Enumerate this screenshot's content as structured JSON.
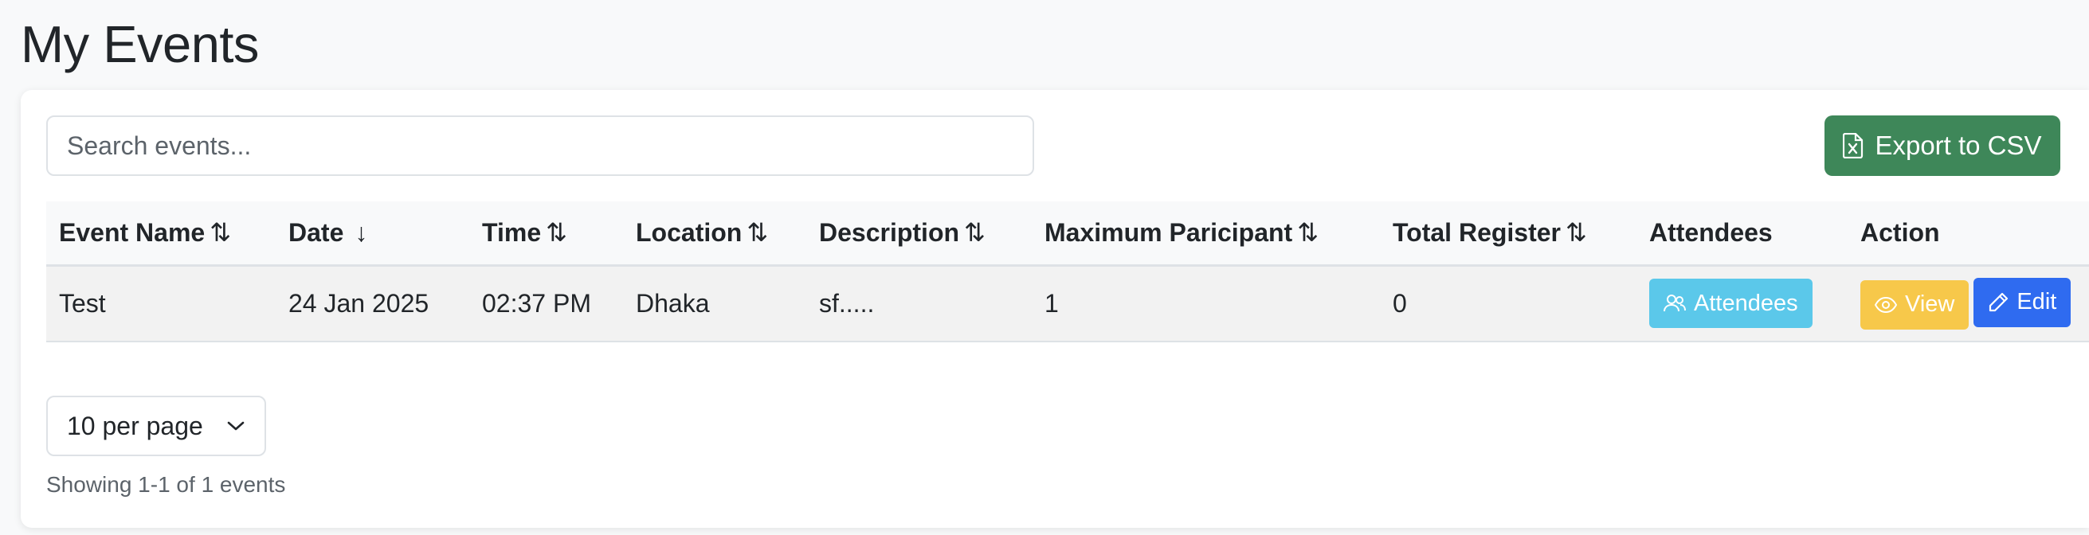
{
  "page": {
    "title": "My Events"
  },
  "toolbar": {
    "search_placeholder": "Search events...",
    "export_label": "Export to CSV"
  },
  "table": {
    "headers": [
      {
        "label": "Event Name",
        "sort_icon": "⇅"
      },
      {
        "label": "Date",
        "sort_icon": "↓"
      },
      {
        "label": "Time",
        "sort_icon": "⇅"
      },
      {
        "label": "Location",
        "sort_icon": "⇅"
      },
      {
        "label": "Description",
        "sort_icon": "⇅"
      },
      {
        "label": "Maximum Paricipant",
        "sort_icon": "⇅"
      },
      {
        "label": "Total Register",
        "sort_icon": "⇅"
      },
      {
        "label": "Attendees",
        "sort_icon": ""
      },
      {
        "label": "Action",
        "sort_icon": ""
      }
    ],
    "rows": [
      {
        "name": "Test",
        "date": "24 Jan 2025",
        "time": "02:37 PM",
        "location": "Dhaka",
        "description": "sf.....",
        "max_participants": "1",
        "total_register": "0",
        "attendees_label": "Attendees",
        "view_label": "View",
        "edit_label": "Edit"
      }
    ]
  },
  "pagination": {
    "per_page_label": "10 per page",
    "showing_text": "Showing 1-1 of 1 events"
  },
  "colors": {
    "export": "#3e8759",
    "info": "#5bc8ea",
    "warning": "#f7c84a",
    "primary": "#2f6bf0"
  },
  "icons": {
    "export": "file-excel-icon",
    "attendees": "people-icon",
    "view": "eye-icon",
    "edit": "pencil-icon",
    "perpage": "chevron-down-icon"
  }
}
